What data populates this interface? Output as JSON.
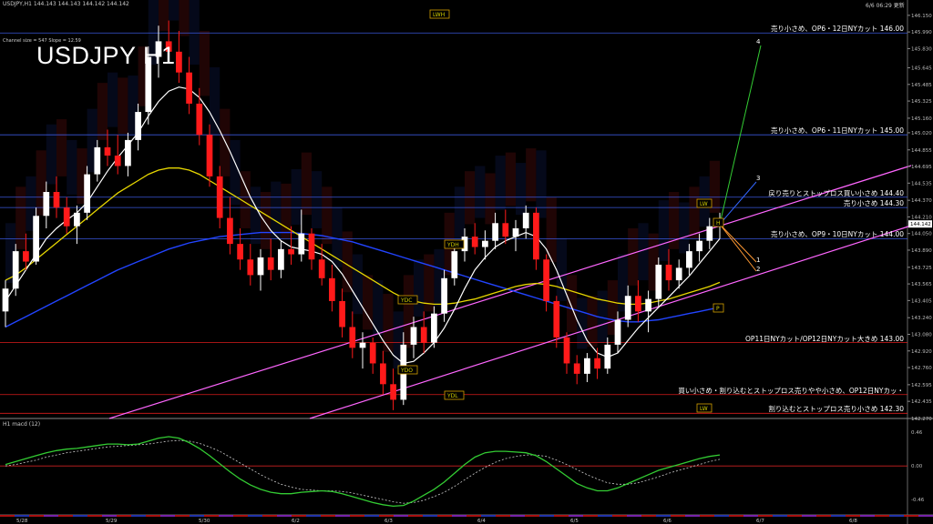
{
  "header": {
    "symbol_line": "USDJPY,H1  144.143 144.143 144.142 144.142",
    "timestamp": "6/6 06:29 更新",
    "channel_info": "Channel size = 547 Slope = 12.59",
    "big_title": "USDJPY H1",
    "subwindow_label": "H1  macd (12)"
  },
  "colors": {
    "background": "#000000",
    "bull_candle": "#ffffff",
    "bear_candle": "#ff1a1a",
    "channel": "#ff66ff",
    "ma_fast": "#ffffff",
    "ma_mid": "#e6d600",
    "ma_slow": "#2244ff",
    "macd_line": "#33cc33",
    "macd_signal": "#cc66aa"
  },
  "chart_data": {
    "type": "candlestick",
    "y_axis_ticks": [
      "146.150",
      "145.990",
      "145.830",
      "145.645",
      "145.485",
      "145.325",
      "145.160",
      "145.020",
      "144.855",
      "144.695",
      "144.535",
      "144.370",
      "144.210",
      "144.050",
      "143.890",
      "143.725",
      "143.565",
      "143.405",
      "143.240",
      "143.080",
      "142.920",
      "142.760",
      "142.595",
      "142.435",
      "142.270"
    ],
    "ylim": [
      142.27,
      146.21
    ],
    "x_axis_ticks": [
      "5/28",
      "5/29",
      "5/30",
      "6/2",
      "6/3",
      "6/4",
      "6/5",
      "6/6",
      "6/7",
      "6/8"
    ],
    "current_price_label": "144.142",
    "candles": [
      {
        "o": 143.3,
        "h": 143.6,
        "l": 143.15,
        "c": 143.52
      },
      {
        "o": 143.52,
        "h": 143.95,
        "l": 143.45,
        "c": 143.88
      },
      {
        "o": 143.88,
        "h": 144.05,
        "l": 143.7,
        "c": 143.78
      },
      {
        "o": 143.78,
        "h": 144.3,
        "l": 143.75,
        "c": 144.22
      },
      {
        "o": 144.22,
        "h": 144.55,
        "l": 144.1,
        "c": 144.45
      },
      {
        "o": 144.45,
        "h": 144.6,
        "l": 144.2,
        "c": 144.3
      },
      {
        "o": 144.3,
        "h": 144.4,
        "l": 144.05,
        "c": 144.12
      },
      {
        "o": 144.12,
        "h": 144.32,
        "l": 143.95,
        "c": 144.25
      },
      {
        "o": 144.25,
        "h": 144.7,
        "l": 144.18,
        "c": 144.62
      },
      {
        "o": 144.62,
        "h": 144.95,
        "l": 144.55,
        "c": 144.88
      },
      {
        "o": 144.88,
        "h": 145.05,
        "l": 144.7,
        "c": 144.8
      },
      {
        "o": 144.8,
        "h": 145.0,
        "l": 144.62,
        "c": 144.7
      },
      {
        "o": 144.7,
        "h": 145.02,
        "l": 144.6,
        "c": 144.95
      },
      {
        "o": 144.95,
        "h": 145.3,
        "l": 144.85,
        "c": 145.22
      },
      {
        "o": 145.22,
        "h": 145.85,
        "l": 145.1,
        "c": 145.75
      },
      {
        "o": 145.75,
        "h": 146.05,
        "l": 145.55,
        "c": 145.9
      },
      {
        "o": 145.9,
        "h": 146.1,
        "l": 145.7,
        "c": 145.8
      },
      {
        "o": 145.8,
        "h": 146.0,
        "l": 145.5,
        "c": 145.6
      },
      {
        "o": 145.6,
        "h": 145.75,
        "l": 145.2,
        "c": 145.3
      },
      {
        "o": 145.3,
        "h": 145.45,
        "l": 144.9,
        "c": 145.0
      },
      {
        "o": 145.0,
        "h": 145.1,
        "l": 144.5,
        "c": 144.6
      },
      {
        "o": 144.6,
        "h": 144.7,
        "l": 144.1,
        "c": 144.2
      },
      {
        "o": 144.2,
        "h": 144.4,
        "l": 143.85,
        "c": 143.95
      },
      {
        "o": 143.95,
        "h": 144.1,
        "l": 143.7,
        "c": 143.8
      },
      {
        "o": 143.8,
        "h": 143.95,
        "l": 143.55,
        "c": 143.65
      },
      {
        "o": 143.65,
        "h": 143.9,
        "l": 143.5,
        "c": 143.82
      },
      {
        "o": 143.82,
        "h": 144.0,
        "l": 143.6,
        "c": 143.7
      },
      {
        "o": 143.7,
        "h": 143.98,
        "l": 143.62,
        "c": 143.9
      },
      {
        "o": 143.9,
        "h": 144.12,
        "l": 143.75,
        "c": 143.85
      },
      {
        "o": 143.85,
        "h": 144.28,
        "l": 143.78,
        "c": 144.05
      },
      {
        "o": 144.05,
        "h": 144.1,
        "l": 143.7,
        "c": 143.8
      },
      {
        "o": 143.8,
        "h": 143.95,
        "l": 143.55,
        "c": 143.62
      },
      {
        "o": 143.62,
        "h": 143.75,
        "l": 143.3,
        "c": 143.4
      },
      {
        "o": 143.4,
        "h": 143.52,
        "l": 143.05,
        "c": 143.15
      },
      {
        "o": 143.15,
        "h": 143.3,
        "l": 142.85,
        "c": 142.95
      },
      {
        "o": 142.95,
        "h": 143.1,
        "l": 142.75,
        "c": 143.0
      },
      {
        "o": 143.0,
        "h": 143.05,
        "l": 142.7,
        "c": 142.8
      },
      {
        "o": 142.8,
        "h": 142.92,
        "l": 142.5,
        "c": 142.6
      },
      {
        "o": 142.6,
        "h": 142.75,
        "l": 142.35,
        "c": 142.45
      },
      {
        "o": 142.45,
        "h": 143.1,
        "l": 142.4,
        "c": 142.98
      },
      {
        "o": 142.98,
        "h": 143.25,
        "l": 142.85,
        "c": 143.15
      },
      {
        "o": 143.15,
        "h": 143.3,
        "l": 142.9,
        "c": 143.0
      },
      {
        "o": 143.0,
        "h": 143.35,
        "l": 142.95,
        "c": 143.28
      },
      {
        "o": 143.28,
        "h": 143.7,
        "l": 143.2,
        "c": 143.62
      },
      {
        "o": 143.62,
        "h": 143.95,
        "l": 143.55,
        "c": 143.88
      },
      {
        "o": 143.88,
        "h": 144.1,
        "l": 143.78,
        "c": 144.02
      },
      {
        "o": 144.02,
        "h": 144.15,
        "l": 143.85,
        "c": 143.92
      },
      {
        "o": 143.92,
        "h": 144.08,
        "l": 143.8,
        "c": 143.98
      },
      {
        "o": 143.98,
        "h": 144.25,
        "l": 143.9,
        "c": 144.15
      },
      {
        "o": 144.15,
        "h": 144.28,
        "l": 143.95,
        "c": 144.02
      },
      {
        "o": 144.02,
        "h": 144.18,
        "l": 143.88,
        "c": 144.1
      },
      {
        "o": 144.1,
        "h": 144.32,
        "l": 144.0,
        "c": 144.25
      },
      {
        "o": 144.25,
        "h": 144.3,
        "l": 143.7,
        "c": 143.8
      },
      {
        "o": 143.8,
        "h": 143.85,
        "l": 143.3,
        "c": 143.4
      },
      {
        "o": 143.4,
        "h": 143.45,
        "l": 142.95,
        "c": 143.05
      },
      {
        "o": 143.05,
        "h": 143.1,
        "l": 142.7,
        "c": 142.8
      },
      {
        "o": 142.8,
        "h": 142.88,
        "l": 142.6,
        "c": 142.7
      },
      {
        "o": 142.7,
        "h": 142.9,
        "l": 142.62,
        "c": 142.85
      },
      {
        "o": 142.85,
        "h": 142.95,
        "l": 142.65,
        "c": 142.75
      },
      {
        "o": 142.75,
        "h": 143.05,
        "l": 142.7,
        "c": 142.98
      },
      {
        "o": 142.98,
        "h": 143.3,
        "l": 142.9,
        "c": 143.22
      },
      {
        "o": 143.22,
        "h": 143.55,
        "l": 143.15,
        "c": 143.45
      },
      {
        "o": 143.45,
        "h": 143.6,
        "l": 143.2,
        "c": 143.3
      },
      {
        "o": 143.3,
        "h": 143.5,
        "l": 143.1,
        "c": 143.42
      },
      {
        "o": 143.42,
        "h": 143.82,
        "l": 143.35,
        "c": 143.75
      },
      {
        "o": 143.75,
        "h": 143.9,
        "l": 143.5,
        "c": 143.6
      },
      {
        "o": 143.6,
        "h": 143.8,
        "l": 143.52,
        "c": 143.72
      },
      {
        "o": 143.72,
        "h": 143.95,
        "l": 143.65,
        "c": 143.88
      },
      {
        "o": 143.88,
        "h": 144.05,
        "l": 143.78,
        "c": 143.98
      },
      {
        "o": 143.98,
        "h": 144.2,
        "l": 143.9,
        "c": 144.12
      },
      {
        "o": 144.12,
        "h": 144.25,
        "l": 144.0,
        "c": 144.14
      }
    ],
    "ma_fast": [
      143.4,
      143.55,
      143.7,
      143.85,
      144.0,
      144.1,
      144.18,
      144.25,
      144.35,
      144.5,
      144.65,
      144.78,
      144.9,
      145.02,
      145.18,
      145.32,
      145.42,
      145.46,
      145.44,
      145.36,
      145.22,
      145.04,
      144.84,
      144.62,
      144.4,
      144.22,
      144.08,
      143.98,
      143.92,
      143.9,
      143.88,
      143.85,
      143.78,
      143.66,
      143.5,
      143.34,
      143.18,
      143.02,
      142.88,
      142.8,
      142.82,
      142.9,
      143.0,
      143.14,
      143.32,
      143.52,
      143.7,
      143.82,
      143.92,
      143.98,
      144.02,
      144.06,
      144.02,
      143.9,
      143.7,
      143.46,
      143.22,
      143.02,
      142.9,
      142.86,
      142.9,
      143.02,
      143.14,
      143.24,
      143.34,
      143.44,
      143.54,
      143.64,
      143.76,
      143.88,
      144.0
    ],
    "ma_mid": [
      143.6,
      143.65,
      143.72,
      143.8,
      143.88,
      143.96,
      144.04,
      144.12,
      144.2,
      144.28,
      144.36,
      144.44,
      144.5,
      144.56,
      144.62,
      144.66,
      144.68,
      144.68,
      144.66,
      144.62,
      144.56,
      144.5,
      144.44,
      144.38,
      144.32,
      144.26,
      144.2,
      144.14,
      144.08,
      144.02,
      143.96,
      143.9,
      143.84,
      143.78,
      143.72,
      143.66,
      143.6,
      143.54,
      143.48,
      143.43,
      143.4,
      143.38,
      143.37,
      143.37,
      143.38,
      143.4,
      143.42,
      143.45,
      143.48,
      143.51,
      143.54,
      143.56,
      143.57,
      143.56,
      143.54,
      143.51,
      143.48,
      143.45,
      143.42,
      143.4,
      143.38,
      143.37,
      143.37,
      143.38,
      143.4,
      143.42,
      143.45,
      143.48,
      143.51,
      143.54,
      143.58
    ],
    "ma_slow": [
      143.15,
      143.2,
      143.25,
      143.3,
      143.35,
      143.4,
      143.45,
      143.5,
      143.55,
      143.6,
      143.65,
      143.7,
      143.74,
      143.78,
      143.82,
      143.86,
      143.9,
      143.93,
      143.96,
      143.98,
      144.0,
      144.02,
      144.03,
      144.04,
      144.05,
      144.06,
      144.06,
      144.06,
      144.06,
      144.05,
      144.04,
      144.03,
      144.01,
      143.99,
      143.97,
      143.94,
      143.91,
      143.88,
      143.85,
      143.82,
      143.79,
      143.76,
      143.73,
      143.7,
      143.67,
      143.64,
      143.61,
      143.58,
      143.55,
      143.52,
      143.49,
      143.46,
      143.43,
      143.4,
      143.37,
      143.34,
      143.31,
      143.28,
      143.25,
      143.23,
      143.21,
      143.2,
      143.2,
      143.21,
      143.22,
      143.24,
      143.26,
      143.28,
      143.3,
      143.32,
      143.34
    ],
    "macd": {
      "macd_line": [
        0.02,
        0.06,
        0.1,
        0.14,
        0.18,
        0.21,
        0.23,
        0.24,
        0.26,
        0.28,
        0.3,
        0.3,
        0.29,
        0.3,
        0.34,
        0.38,
        0.4,
        0.38,
        0.32,
        0.24,
        0.14,
        0.03,
        -0.08,
        -0.18,
        -0.26,
        -0.32,
        -0.36,
        -0.38,
        -0.38,
        -0.36,
        -0.35,
        -0.34,
        -0.35,
        -0.38,
        -0.42,
        -0.46,
        -0.5,
        -0.53,
        -0.55,
        -0.54,
        -0.48,
        -0.4,
        -0.32,
        -0.22,
        -0.1,
        0.02,
        0.12,
        0.18,
        0.2,
        0.2,
        0.19,
        0.18,
        0.14,
        0.06,
        -0.04,
        -0.14,
        -0.24,
        -0.3,
        -0.34,
        -0.34,
        -0.3,
        -0.24,
        -0.18,
        -0.12,
        -0.06,
        -0.02,
        0.02,
        0.06,
        0.1,
        0.13,
        0.15
      ],
      "signal_line": [
        0.0,
        0.02,
        0.05,
        0.08,
        0.12,
        0.15,
        0.18,
        0.2,
        0.22,
        0.24,
        0.26,
        0.27,
        0.28,
        0.29,
        0.3,
        0.32,
        0.34,
        0.35,
        0.34,
        0.31,
        0.26,
        0.2,
        0.12,
        0.04,
        -0.04,
        -0.12,
        -0.19,
        -0.25,
        -0.29,
        -0.32,
        -0.33,
        -0.34,
        -0.34,
        -0.35,
        -0.37,
        -0.4,
        -0.43,
        -0.46,
        -0.49,
        -0.51,
        -0.5,
        -0.47,
        -0.42,
        -0.36,
        -0.28,
        -0.19,
        -0.1,
        -0.02,
        0.05,
        0.1,
        0.13,
        0.15,
        0.15,
        0.13,
        0.08,
        0.02,
        -0.05,
        -0.12,
        -0.18,
        -0.23,
        -0.25,
        -0.25,
        -0.23,
        -0.19,
        -0.15,
        -0.1,
        -0.06,
        -0.02,
        0.02,
        0.06,
        0.09
      ],
      "ticks": [
        "0.46",
        "0.00",
        "-0.46"
      ],
      "ylim": [
        -0.62,
        0.5
      ]
    },
    "horizontal_levels": [
      {
        "value": 145.98,
        "text": "売り小さめ、OP6・12日NYカット 146.00",
        "color": "#4466ff"
      },
      {
        "value": 145.0,
        "text": "売り小さめ、OP6・11日NYカット 145.00",
        "color": "#4466ff"
      },
      {
        "value": 144.4,
        "text": "戻り売りとストップロス買い小さめ 144.40",
        "color": "#4466ff"
      },
      {
        "value": 144.3,
        "text": "売り小さめ 144.30",
        "color": "#4466ff"
      },
      {
        "value": 144.0,
        "text": "売り小さめ、OP9・10日NYカット 144.00",
        "color": "#4466ff"
      },
      {
        "value": 143.0,
        "text": "OP11日NYカット/OP12日NYカット大きめ 143.00",
        "color": "#ff2222"
      },
      {
        "value": 142.5,
        "text": "買い小さめ・割り込むとストップロス売りやや小さめ、OP12日NYカッ・",
        "color": "#ff2222"
      },
      {
        "value": 142.32,
        "text": "割り込むとストップロス売り小さめ 142.30",
        "color": "#ff2222"
      }
    ],
    "price_boxes": [
      "LWH",
      "LW",
      "LW",
      "YDH",
      "YDC",
      "YDO",
      "YDL",
      "H",
      "P"
    ],
    "channel_labels": [
      "4",
      "3",
      "1",
      "2"
    ]
  }
}
